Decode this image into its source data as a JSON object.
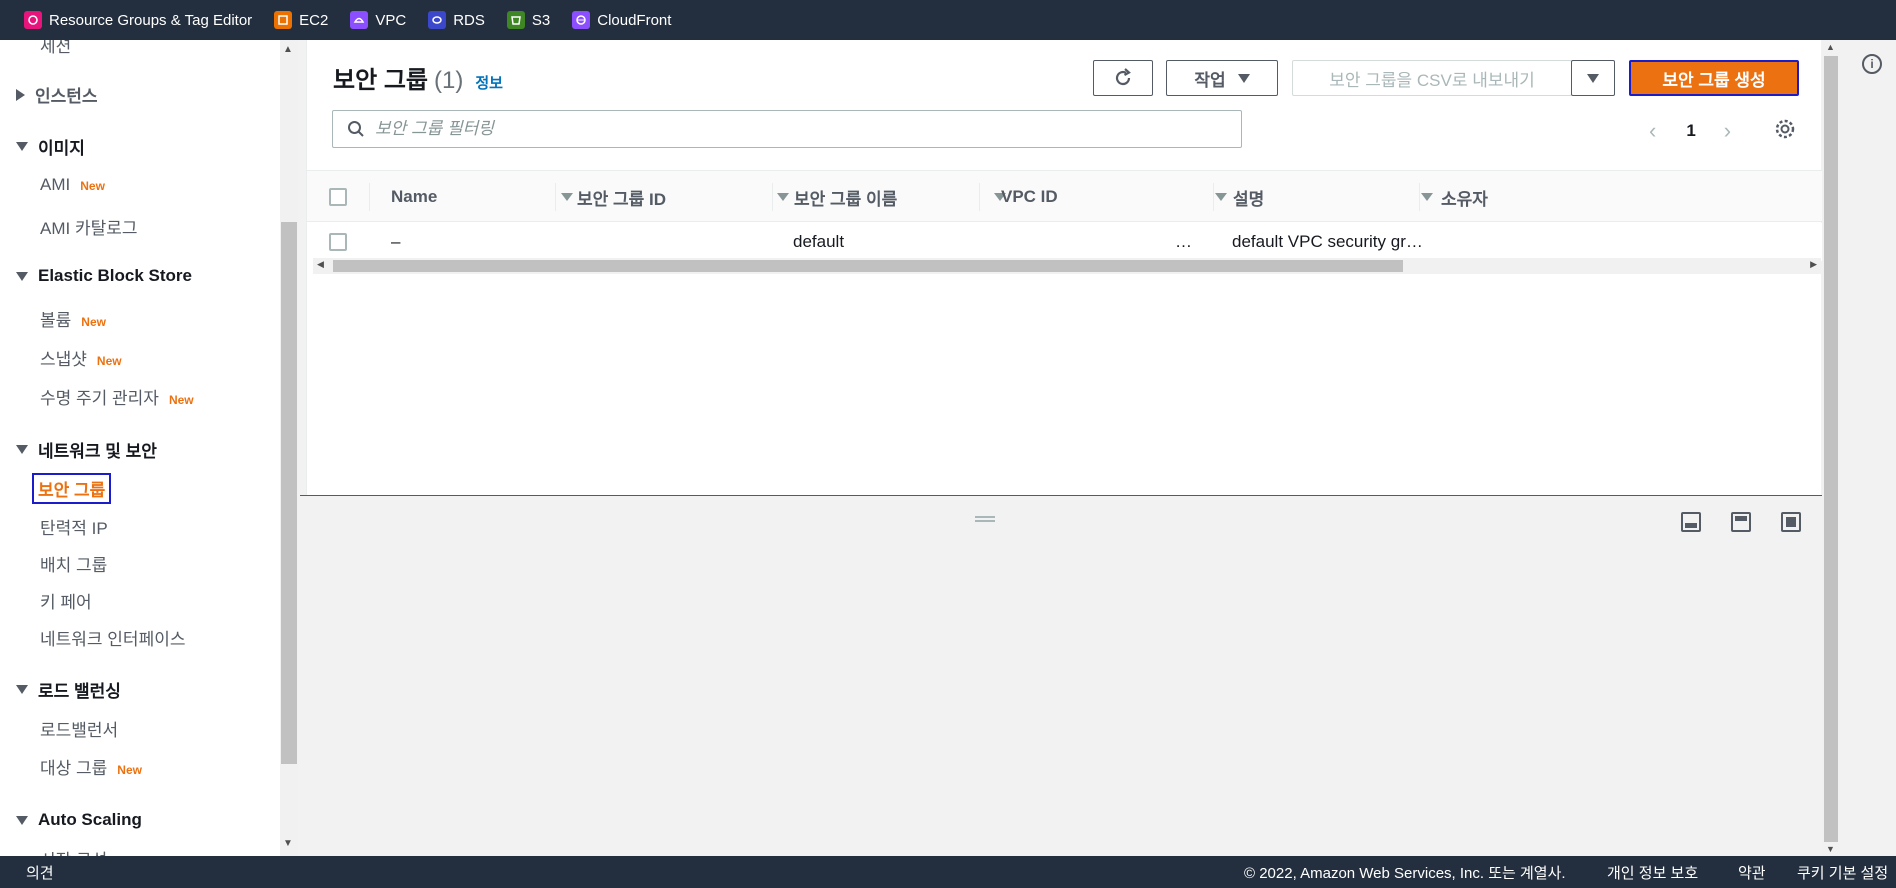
{
  "topbar": {
    "favorites": [
      {
        "label": "Resource Groups & Tag Editor",
        "color": "#e7157b",
        "icon": "resource-groups-icon"
      },
      {
        "label": "EC2",
        "color": "#ed7100",
        "icon": "ec2-icon"
      },
      {
        "label": "VPC",
        "color": "#8c4fff",
        "icon": "vpc-icon"
      },
      {
        "label": "RDS",
        "color": "#3b48cc",
        "icon": "rds-icon"
      },
      {
        "label": "S3",
        "color": "#3f8624",
        "icon": "s3-icon"
      },
      {
        "label": "CloudFront",
        "color": "#8c4fff",
        "icon": "cloudfront-icon"
      }
    ]
  },
  "sidebar": {
    "partial_top": "세션",
    "instances": "인스턴스",
    "images": {
      "title": "이미지",
      "items": [
        {
          "label": "AMI",
          "badge": "New"
        },
        {
          "label": "AMI 카탈로그"
        }
      ]
    },
    "ebs": {
      "title": "Elastic Block Store",
      "items": [
        {
          "label": "볼륨",
          "badge": "New"
        },
        {
          "label": "스냅샷",
          "badge": "New"
        },
        {
          "label": "수명 주기 관리자",
          "badge": "New"
        }
      ]
    },
    "network": {
      "title": "네트워크 및 보안",
      "items": [
        {
          "label": "보안 그룹"
        },
        {
          "label": "탄력적 IP"
        },
        {
          "label": "배치 그룹"
        },
        {
          "label": "키 페어"
        },
        {
          "label": "네트워크 인터페이스"
        }
      ]
    },
    "lb": {
      "title": "로드 밸런싱",
      "items": [
        {
          "label": "로드밸런서"
        },
        {
          "label": "대상 그룹",
          "badge": "New"
        }
      ]
    },
    "autoscaling": {
      "title": "Auto Scaling",
      "partial": "시작 구성"
    }
  },
  "main": {
    "title": "보안 그룹",
    "count": "(1)",
    "info": "정보",
    "actions_label": "작업",
    "export_label": "보안 그룹을 CSV로 내보내기",
    "create_label": "보안 그룹 생성",
    "search_placeholder": "보안 그룹 필터링",
    "page": "1",
    "columns": [
      "Name",
      "보안 그룹 ID",
      "보안 그룹 이름",
      "VPC ID",
      "설명",
      "소유자"
    ],
    "rows": [
      {
        "name": "–",
        "sg_id": "",
        "sg_name": "default",
        "vpc_id": "…",
        "description": "default VPC security gr…",
        "owner": ""
      }
    ]
  },
  "footer": {
    "feedback": "의견",
    "copyright": "© 2022, Amazon Web Services, Inc. 또는 계열사.",
    "privacy": "개인 정보 보호",
    "terms": "약관",
    "cookies": "쿠키 기본 설정"
  }
}
